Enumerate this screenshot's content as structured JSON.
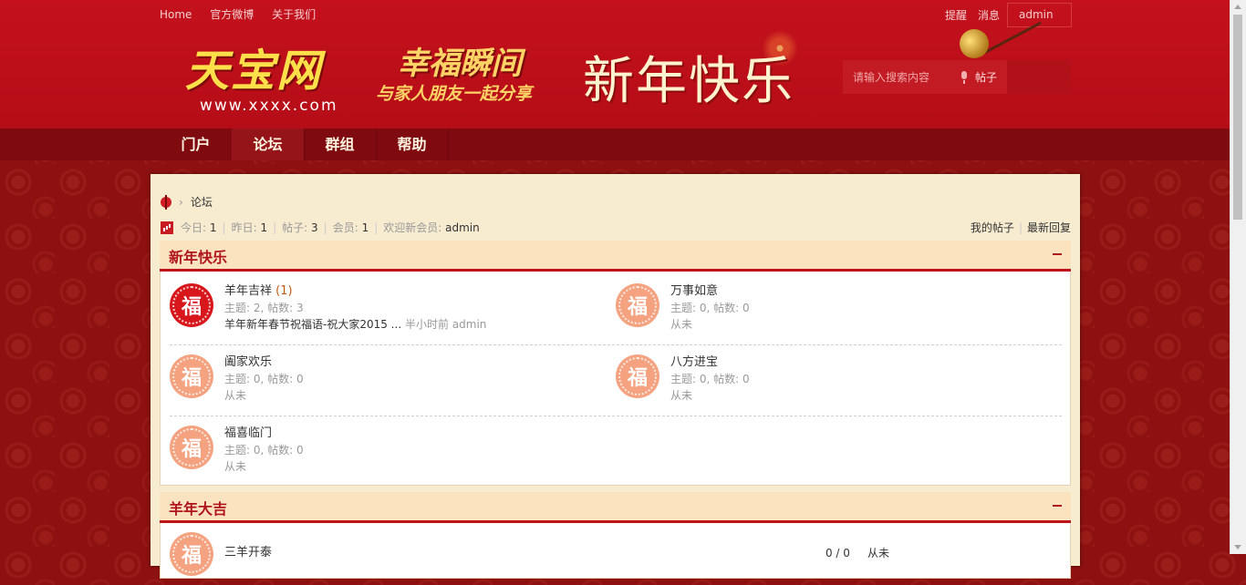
{
  "topnav": {
    "links": [
      "Home",
      "官方微博",
      "关于我们"
    ]
  },
  "topright": {
    "links": [
      "提醒",
      "消息"
    ],
    "user": "admin"
  },
  "logo": {
    "title": "天宝网",
    "url": "www.xxxx.com"
  },
  "banner": {
    "line1": "幸福瞬间",
    "line2": "与家人朋友一起分享",
    "line3": "新年快乐"
  },
  "search": {
    "placeholder": "请输入搜索内容",
    "type": "帖子"
  },
  "mainnav": {
    "items": [
      "门户",
      "论坛",
      "群组",
      "帮助"
    ],
    "active_index": 1
  },
  "breadcrumb": {
    "current": "论坛"
  },
  "stats": {
    "today_label": "今日:",
    "today": "1",
    "yesterday_label": "昨日:",
    "yesterday": "1",
    "posts_label": "帖子:",
    "posts": "3",
    "members_label": "会员:",
    "members": "1",
    "newmember_label": "欢迎新会员:",
    "newmember": "admin"
  },
  "rlinks": {
    "my_posts": "我的帖子",
    "latest": "最新回复"
  },
  "icon_char": "福",
  "sections": [
    {
      "title": "新年快乐",
      "forums": [
        {
          "name": "羊年吉祥",
          "count": "(1)",
          "meta": "主题: 2, 帖数: 3",
          "last_title": "羊年新年春节祝福语-祝大家2015 ...",
          "last_time": "半小时前",
          "last_user": "admin",
          "hot": true
        },
        {
          "name": "万事如意",
          "meta": "主题: 0, 帖数: 0",
          "last": "从未"
        },
        {
          "name": "阖家欢乐",
          "meta": "主题: 0, 帖数: 0",
          "last": "从未"
        },
        {
          "name": "八方进宝",
          "meta": "主题: 0, 帖数: 0",
          "last": "从未"
        },
        {
          "name": "福喜临门",
          "meta": "主题: 0, 帖数: 0",
          "last": "从未"
        }
      ]
    },
    {
      "title": "羊年大吉",
      "forums": [
        {
          "name": "三羊开泰",
          "stats": "0 / 0",
          "last": "从未"
        }
      ]
    }
  ],
  "colors": {
    "header": "#c4111d",
    "nav": "#7f0b11",
    "accent": "#b0141b",
    "panel": "#f7ebd0"
  }
}
